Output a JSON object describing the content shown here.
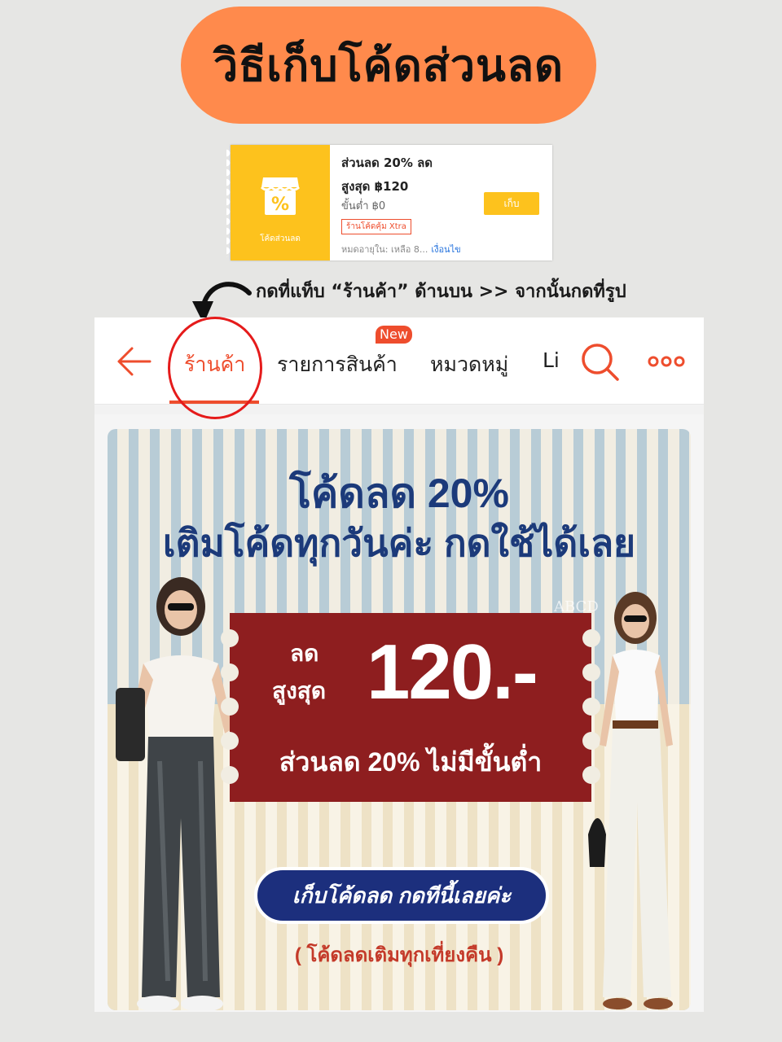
{
  "title": "วิธีเก็บโค้ดส่วนลด",
  "voucher": {
    "tag_label": "โค้ดส่วนลด",
    "title_line1": "ส่วนลด 20% ลด",
    "title_line2": "สูงสุด ฿120",
    "min_spend": "ขั้นต่ำ ฿0",
    "badge": "ร้านโค้ดคุ้ม Xtra",
    "expiry": "หมดอายุใน:  เหลือ 8...",
    "conditions_link": "เงื่อนไข",
    "collect_button": "เก็บ",
    "accent_color": "#fdc21d"
  },
  "instruction": "กดที่แท็บ “ร้านค้า” ด้านบน >> จากนั้นกดที่รูป",
  "shop_nav": {
    "tabs": [
      {
        "label": "ร้านค้า",
        "active": true
      },
      {
        "label": "รายการสินค้า",
        "badge": "New"
      },
      {
        "label": "หมวดหมู่"
      },
      {
        "label": "Li"
      }
    ],
    "icons": [
      "back-arrow-icon",
      "search-icon",
      "more-icon"
    ],
    "accent_color": "#ee4d2d"
  },
  "banner": {
    "headline_line1": "โค้ดลด 20%",
    "headline_line2": "เติมโค้ดทุกวันค่ะ กดใช้ได้เลย",
    "ticket_label_line1": "ลด",
    "ticket_label_line2": "สูงสุด",
    "ticket_amount": "120.-",
    "ticket_subtitle": "ส่วนลด 20% ไม่มีขั้นต่ำ",
    "cta": "เก็บโค้ดลด กดทีนี้เลยค่ะ",
    "refill_note": "( โค้ดลดเติมทุกเที่ยงคืน )",
    "watermark": "ABCD"
  }
}
